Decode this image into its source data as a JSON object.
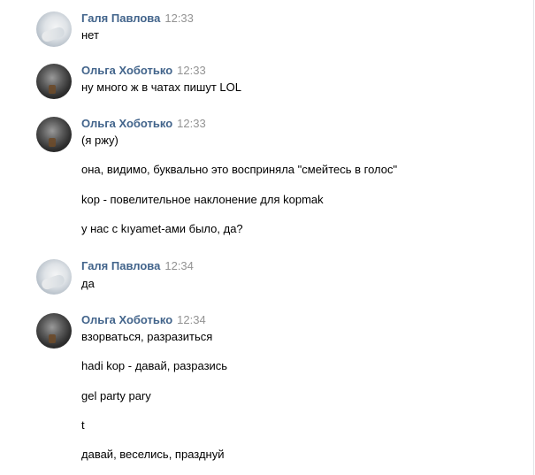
{
  "messages": [
    {
      "author": "Галя Павлова",
      "time": "12:33",
      "avatar": "avatar-light",
      "lines": [
        "нет"
      ]
    },
    {
      "author": "Ольга Хоботько",
      "time": "12:33",
      "avatar": "avatar-dark",
      "lines": [
        "ну много ж в чатах пишут LOL"
      ]
    },
    {
      "author": "Ольга Хоботько",
      "time": "12:33",
      "avatar": "avatar-dark",
      "lines": [
        "(я ржу)",
        "она, видимо, буквально это восприняла \"смейтесь в голос\"",
        "kop - повелительное наклонение для kopmak",
        "у нас с kıyamet-ами было, да?"
      ]
    },
    {
      "author": "Галя Павлова",
      "time": "12:34",
      "avatar": "avatar-light",
      "lines": [
        "да"
      ]
    },
    {
      "author": "Ольга Хоботько",
      "time": "12:34",
      "avatar": "avatar-dark",
      "lines": [
        "взорваться, разразиться",
        "hadi kop - давай, разразись",
        "gel party pary",
        "t",
        "давай, веселись, празднуй"
      ]
    }
  ],
  "colors": {
    "author": "#42648b",
    "time": "#939393",
    "text": "#000000"
  }
}
